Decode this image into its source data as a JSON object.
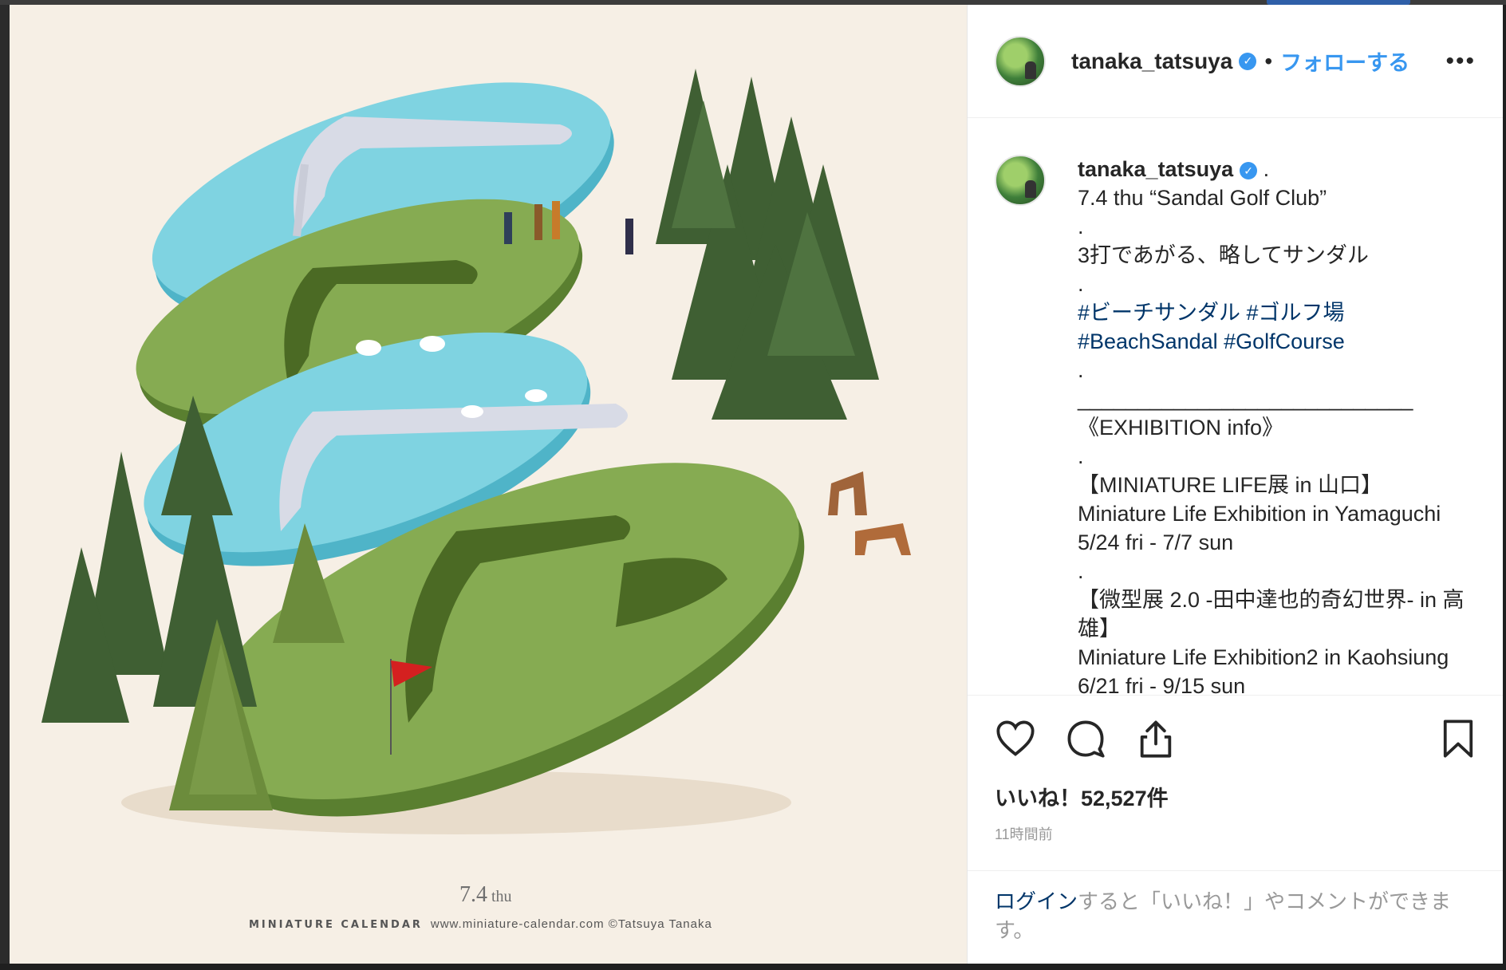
{
  "header": {
    "username": "tanaka_tatsuya",
    "separator": "•",
    "follow_label": "フォローする",
    "more_label": "•••"
  },
  "caption": {
    "username": "tanaka_tatsuya",
    "username_suffix": ".",
    "lines": [
      "7.4 thu “Sandal Golf Club”",
      ".",
      "3打であがる、略してサンダル",
      "."
    ],
    "hashtags_1": "#ビーチサンダル #ゴルフ場",
    "hashtags_2": "#BeachSandal #GolfCourse",
    "lines_2": [
      ".",
      "____________________________",
      "《EXHIBITION info》",
      ".",
      "【MINIATURE LIFE展 in 山口】",
      "Miniature Life Exhibition in Yamaguchi",
      "5/24 fri - 7/7 sun",
      ".",
      "【微型展 2.0 -田中達也的奇幻世界- in 高雄】",
      "Miniature Life Exhibition2 in Kaohsiung",
      "6/21 fri - 9/15 sun"
    ]
  },
  "image_caption": {
    "date": "7.4",
    "weekday": "thu",
    "brand": "MINIATURE CALENDAR",
    "url_credit": "www.miniature-calendar.com ©Tatsuya Tanaka"
  },
  "engagement": {
    "likes_label": "いいね！52,527件",
    "time_ago": "11時間前"
  },
  "login_prompt": {
    "link": "ログイン",
    "text": "すると「いいね！」やコメントができます。"
  },
  "colors": {
    "accent": "#3897f0",
    "hashtag": "#003569",
    "sandal_blue": "#5fc6d8",
    "sandal_green": "#6e9a3e"
  }
}
